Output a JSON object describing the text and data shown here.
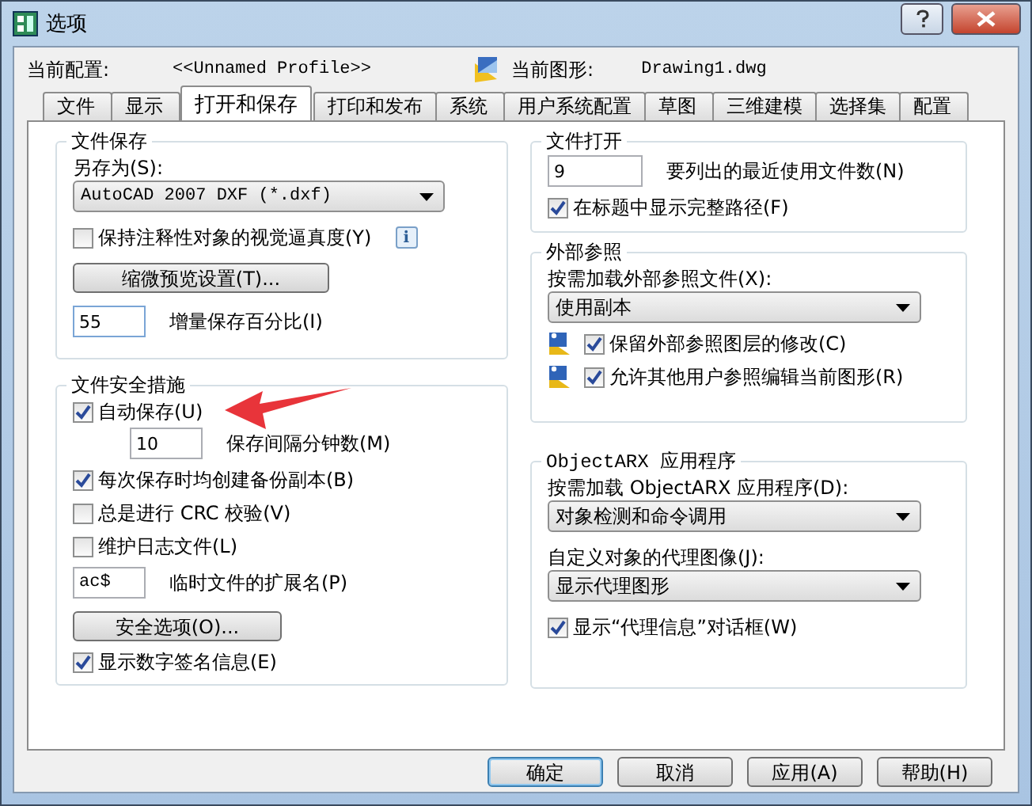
{
  "window": {
    "title": "选项"
  },
  "header": {
    "profile_label": "当前配置:",
    "profile_value": "<<Unnamed Profile>>",
    "drawing_label": "当前图形:",
    "drawing_value": "Drawing1.dwg"
  },
  "tabs": [
    {
      "label": "文件",
      "selected": false
    },
    {
      "label": "显示",
      "selected": false
    },
    {
      "label": "打开和保存",
      "selected": true
    },
    {
      "label": "打印和发布",
      "selected": false
    },
    {
      "label": "系统",
      "selected": false
    },
    {
      "label": "用户系统配置",
      "selected": false
    },
    {
      "label": "草图",
      "selected": false
    },
    {
      "label": "三维建模",
      "selected": false
    },
    {
      "label": "选择集",
      "selected": false
    },
    {
      "label": "配置",
      "selected": false
    }
  ],
  "file_save": {
    "title": "文件保存",
    "save_as_label": "另存为(S):",
    "save_as_value": "AutoCAD 2007 DXF (*.dxf)",
    "annotative": {
      "label": "保持注释性对象的视觉逼真度(Y)",
      "checked": false
    },
    "info": "i",
    "thumbnail_button": "缩微预览设置(T)...",
    "incremental": {
      "value": "55",
      "label": "增量保存百分比(I)"
    }
  },
  "file_safety": {
    "title": "文件安全措施",
    "autosave": {
      "label": "自动保存(U)",
      "checked": true
    },
    "interval": {
      "value": "10",
      "label": "保存间隔分钟数(M)"
    },
    "checks": [
      {
        "label": "每次保存时均创建备份副本(B)",
        "checked": true
      },
      {
        "label": "总是进行 CRC 校验(V)",
        "checked": false
      },
      {
        "label": "维护日志文件(L)",
        "checked": false
      }
    ],
    "temp_ext": {
      "value": "ac$",
      "label": "临时文件的扩展名(P)"
    },
    "security_button": "安全选项(O)...",
    "signature": {
      "label": "显示数字签名信息(E)",
      "checked": true
    }
  },
  "file_open": {
    "title": "文件打开",
    "recent": {
      "value": "9",
      "label": "要列出的最近使用文件数(N)"
    },
    "full_path": {
      "label": "在标题中显示完整路径(F)",
      "checked": true
    }
  },
  "xref": {
    "title": "外部参照",
    "demand_label": "按需加载外部参照文件(X):",
    "demand_value": "使用副本",
    "options": [
      {
        "label": "保留外部参照图层的修改(C)",
        "checked": true
      },
      {
        "label": "允许其他用户参照编辑当前图形(R)",
        "checked": true
      }
    ]
  },
  "objectarx": {
    "title": "ObjectARX 应用程序",
    "load_label": "按需加载 ObjectARX 应用程序(D):",
    "load_value": "对象检测和命令调用",
    "proxy_label": "自定义对象的代理图像(J):",
    "proxy_value": "显示代理图形",
    "proxy_info": {
      "label": "显示“代理信息”对话框(W)",
      "checked": true
    }
  },
  "buttons": [
    {
      "label": "确定",
      "selected": true
    },
    {
      "label": "取消",
      "selected": false
    },
    {
      "label": "应用(A)",
      "selected": false
    },
    {
      "label": "帮助(H)",
      "selected": false
    }
  ]
}
